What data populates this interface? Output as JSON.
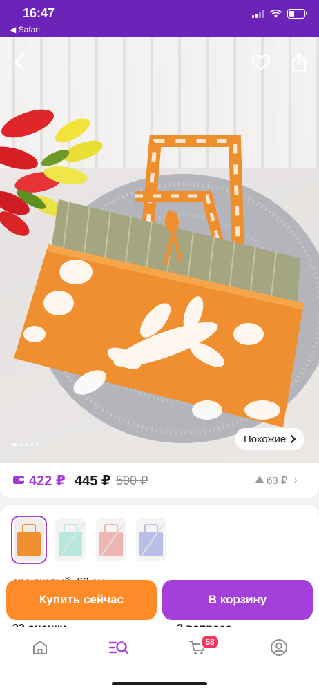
{
  "status_bar": {
    "time": "16:47",
    "back_app": "◀ Safari",
    "battery_percent": 35
  },
  "product_photo": {
    "description_icon": "beach-mat-bag-photo",
    "dot_count": 5,
    "active_dot": 0,
    "similar_button": "Похожие"
  },
  "price": {
    "wallet_price": "422 ₽",
    "price": "445 ₽",
    "old_price": "500 ₽",
    "rating": "63 ₽"
  },
  "variants": {
    "thumbnails": [
      {
        "name": "orange",
        "color": "#ef8f2f",
        "selected": true,
        "available": true
      },
      {
        "name": "mint",
        "color": "#7fd6c2",
        "selected": false,
        "available": false
      },
      {
        "name": "coral",
        "color": "#e07a70",
        "selected": false,
        "available": false
      },
      {
        "name": "blue",
        "color": "#7e8ad6",
        "selected": false,
        "available": false
      }
    ],
    "caption": "оранжевый, 60 см"
  },
  "sections": {
    "reviews_heading": "23 оценки",
    "questions_heading": "2 вопроса"
  },
  "actions": {
    "buy_now": "Купить сейчас",
    "add_to_cart": "В корзину"
  },
  "tabbar": {
    "cart_badge": "58",
    "accent": "#a43fdc"
  },
  "colors": {
    "status_bar_bg": "#6b23b8",
    "buy_button": "#ff8a28",
    "cart_button": "#a43fdc",
    "wallet_price": "#9e3bd7"
  }
}
